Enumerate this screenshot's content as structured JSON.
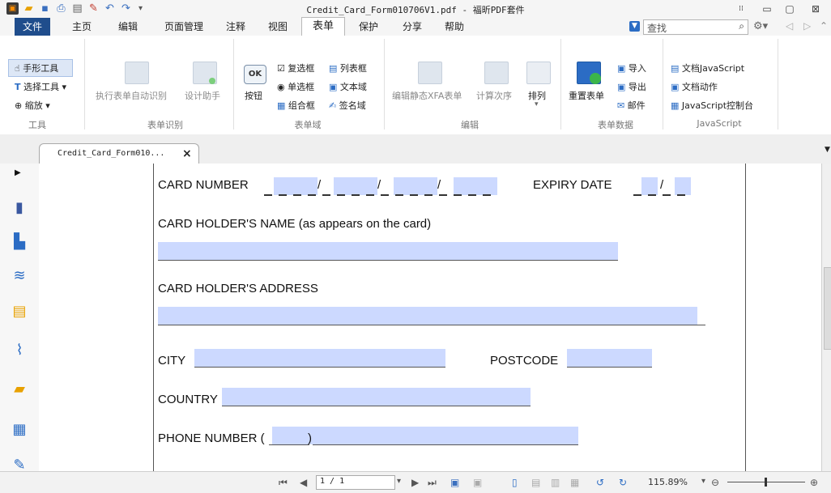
{
  "window": {
    "title": "Credit_Card_Form010706V1.pdf - 福昕PDF套件",
    "quick_access": [
      "save-icon",
      "open-icon",
      "save-icon",
      "print-icon",
      "properties-icon",
      "new-icon",
      "undo-icon",
      "redo-icon"
    ],
    "controls": {
      "ribbon_toggle": "⁞⁞",
      "minimize": "▭",
      "restore": "▢",
      "close": "⊠"
    }
  },
  "menu": {
    "file": "文件",
    "items": [
      "主页",
      "编辑",
      "页面管理",
      "注释",
      "视图",
      "表单",
      "保护",
      "分享",
      "帮助"
    ],
    "active_index": 5,
    "search_placeholder": "查找"
  },
  "ribbon": {
    "tools": {
      "hand": "手形工具",
      "select": "选择工具",
      "zoom": "缩放",
      "group": "工具"
    },
    "recognition": {
      "auto": "执行表单自动识别",
      "assistant": "设计助手",
      "group": "表单识别"
    },
    "fields": {
      "button_icon": "OK",
      "button": "按钮",
      "checkbox": "复选框",
      "radio": "单选框",
      "combobox": "组合框",
      "listbox": "列表框",
      "textfield": "文本域",
      "signature": "签名域",
      "group": "表单域"
    },
    "edit": {
      "xfa": "编辑静态XFA表单",
      "calc": "计算次序",
      "arrange": "排列",
      "group": "编辑"
    },
    "formdata": {
      "reset": "重置表单",
      "import": "导入",
      "export": "导出",
      "email": "邮件",
      "group": "表单数据"
    },
    "javascript": {
      "doc_js": "文档JavaScript",
      "doc_action": "文档动作",
      "console": "JavaScript控制台",
      "group": "JavaScript"
    }
  },
  "tab": {
    "label": "Credit_Card_Form010...",
    "close": "×"
  },
  "form": {
    "card_number": "CARD NUMBER",
    "expiry_date": "EXPIRY DATE",
    "holder_name": "CARD HOLDER'S NAME (as appears on the card)",
    "holder_address": "CARD HOLDER'S ADDRESS",
    "city": "CITY",
    "postcode": "POSTCODE",
    "country": "COUNTRY",
    "phone": "PHONE NUMBER (",
    "phone_close": ")",
    "slash": "/"
  },
  "status": {
    "page": "1 / 1",
    "zoom": "115.89%"
  },
  "colors": {
    "file_menu": "#1f4d8c",
    "field_fill": "#ccd9ff",
    "accent_blue": "#2b6cc4"
  }
}
